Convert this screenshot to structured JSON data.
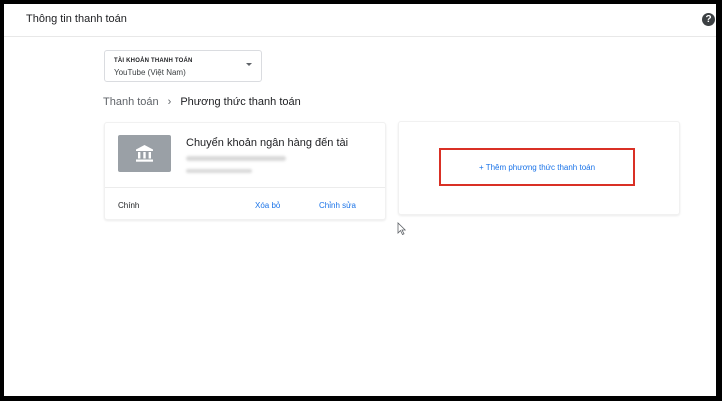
{
  "header": {
    "title": "Thông tin thanh toán",
    "help_icon": "help-circle-icon",
    "help_glyph": "?"
  },
  "account": {
    "caption": "TÀI KHOẢN THANH TOÁN",
    "value": "YouTube (Việt Nam)",
    "icon": "chevron-down-icon"
  },
  "breadcrumb": {
    "parent": "Thanh toán",
    "separator": "›",
    "current": "Phương thức thanh toán"
  },
  "payment_method": {
    "icon": "bank-icon",
    "title": "Chuyển khoản ngân hàng đến tài",
    "primary_label": "Chính",
    "remove_label": "Xóa bỏ",
    "edit_label": "Chỉnh sửa"
  },
  "add_method": {
    "label": "+ Thêm phương thức thanh toán",
    "highlight_color": "#d93025"
  },
  "colors": {
    "link": "#1a73e8",
    "bank_tile": "#9aa0a6"
  }
}
